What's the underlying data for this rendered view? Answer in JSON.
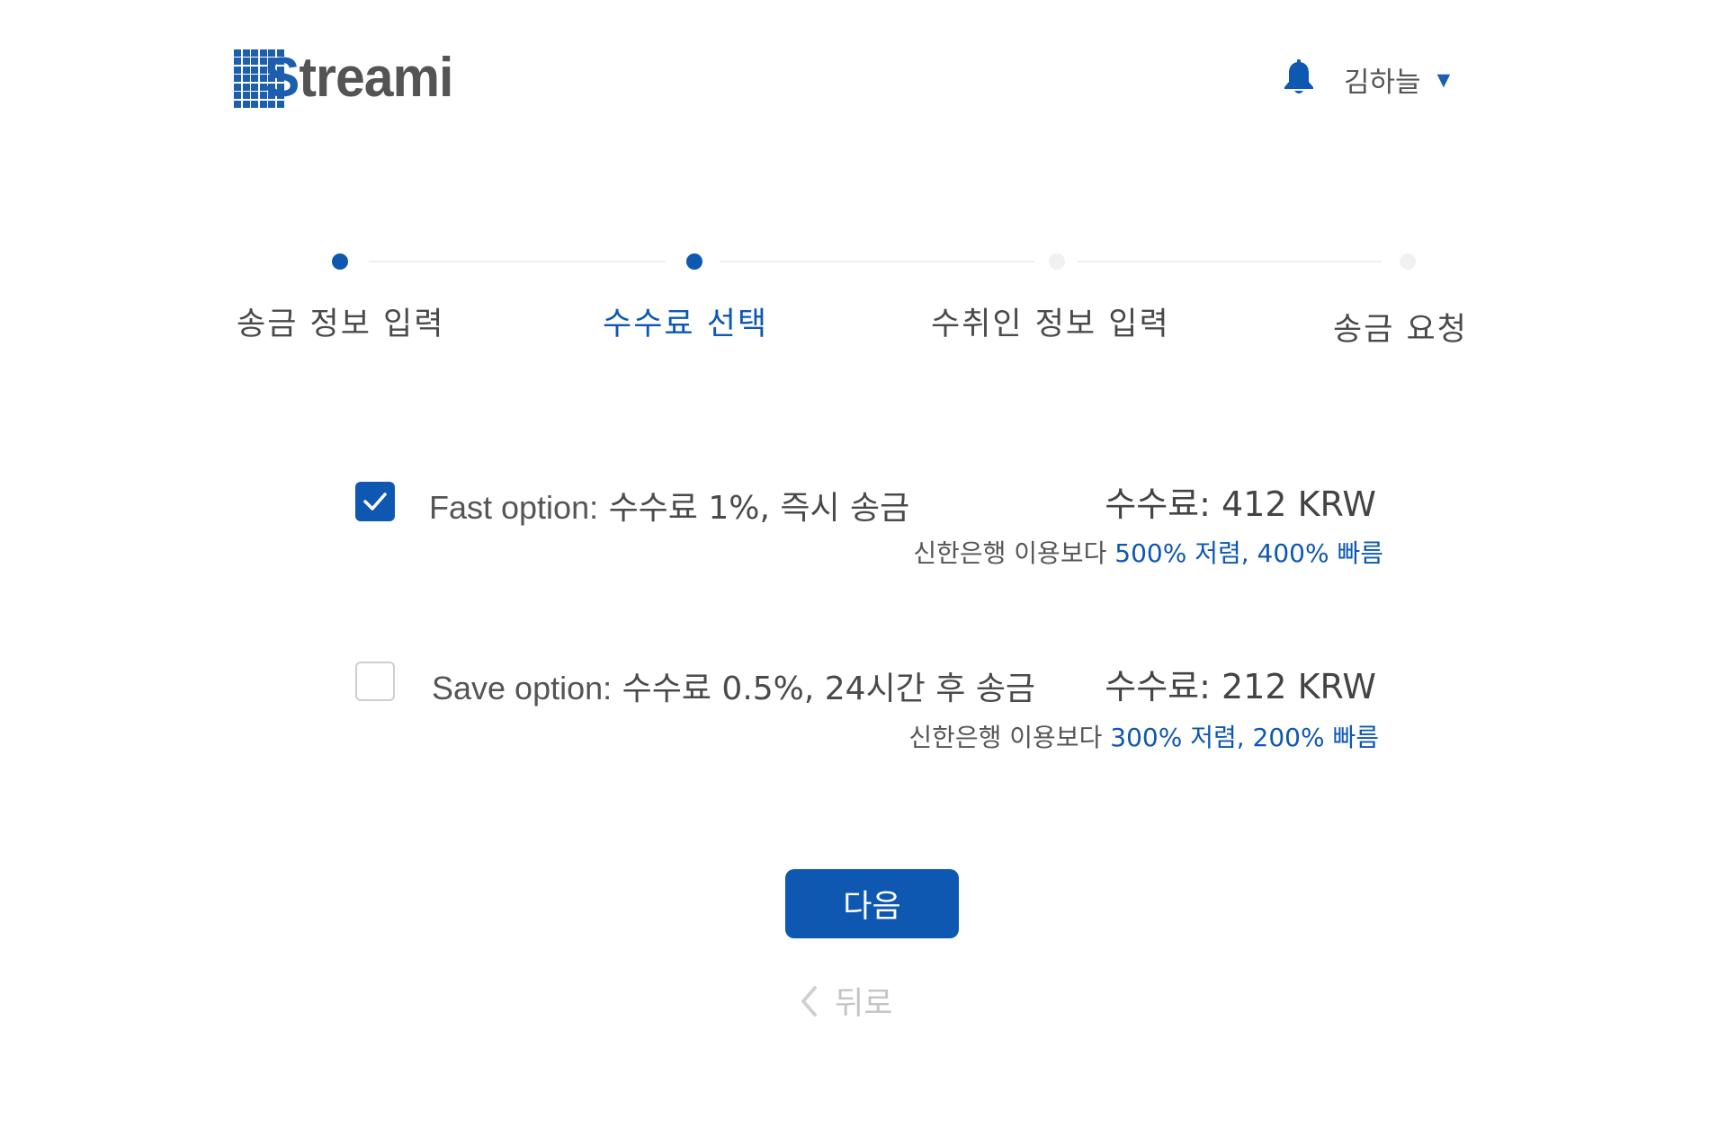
{
  "header": {
    "logo_text": "Streami",
    "user_name": "김하늘",
    "bell_icon": "bell-icon",
    "caret_icon": "caret-down-icon",
    "accent_color": "#0e58b1"
  },
  "steps": [
    {
      "label": "송금 정보 입력",
      "state": "done"
    },
    {
      "label": "수수료 선택",
      "state": "active"
    },
    {
      "label": "수취인 정보 입력",
      "state": "pending"
    },
    {
      "label": "송금 요청",
      "state": "pending"
    }
  ],
  "options": [
    {
      "checked": true,
      "name": "Fast option:",
      "detail": "수수료 1%, 즉시 송금",
      "fee": "수수료: 412 KRW",
      "compare_prefix": "신한은행 이용보다",
      "compare_highlight": "500% 저렴, 400% 빠름"
    },
    {
      "checked": false,
      "name": "Save option:",
      "detail": "수수료 0.5%, 24시간 후 송금",
      "fee": "수수료: 212 KRW",
      "compare_prefix": "신한은행 이용보다",
      "compare_highlight": "300% 저렴, 200% 빠름"
    }
  ],
  "actions": {
    "next_label": "다음",
    "back_label": "뒤로",
    "back_icon": "chevron-left-icon"
  }
}
